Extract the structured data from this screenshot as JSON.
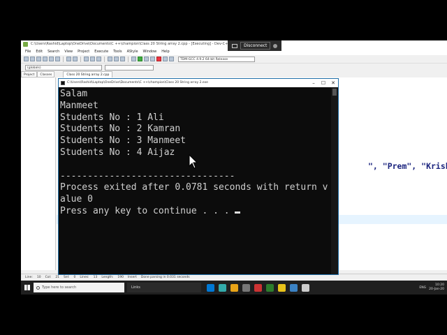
{
  "ide": {
    "title": "C:\\Users\\Rashid\\Laptop\\OneDrive\\Documents\\C ++\\champion\\Class 20 String array 2.cpp - [Executing] - Dev-C++ 5.11",
    "remote_label": "Disconnect",
    "menu": [
      "File",
      "Edit",
      "Search",
      "View",
      "Project",
      "Execute",
      "Tools",
      "AStyle",
      "Window",
      "Help"
    ],
    "compiler": "TDM-GCC 4.9.2 64-bit Release",
    "scope": "(globals)",
    "project_tab": "Project",
    "classes_tab": "Classes",
    "file_tab": "Class 20 String array 2.cpp",
    "code_visible": "\", \"Prem\", \"Krishna\"};",
    "status": {
      "line": "Line:",
      "line_val": "10",
      "col": "Col:",
      "col_val": "21",
      "sel": "Sel:",
      "sel_val": "0",
      "lines": "Lines:",
      "lines_val": "13",
      "length": "Length:",
      "length_val": "190",
      "mode": "Insert",
      "message": "Done parsing in 0.031 seconds"
    }
  },
  "console": {
    "title": "C:\\Users\\Rashid\\Laptop\\OneDrive\\Documents\\C ++\\champion\\Class 20 String array 2.exe",
    "lines": [
      "Salam",
      "Manmeet",
      "Students No : 1 Ali",
      "Students No : 2 Kamran",
      "Students No : 3 Manmeet",
      "Students No : 4 Aijaz",
      "",
      "--------------------------------",
      "Process exited after 0.0781 seconds with return v",
      "alue 0",
      "Press any key to continue . . . "
    ]
  },
  "taskbar": {
    "search_placeholder": "Type here to search",
    "links_label": "Links",
    "lang": "ENG",
    "time": "10:20",
    "date": "20-Jan-20",
    "icon_colors": [
      "#0078d4",
      "#3aa",
      "#e8a317",
      "#777",
      "#c33",
      "#2d7d2d",
      "#e8c21a",
      "#3b82c4",
      "#ccc"
    ]
  }
}
